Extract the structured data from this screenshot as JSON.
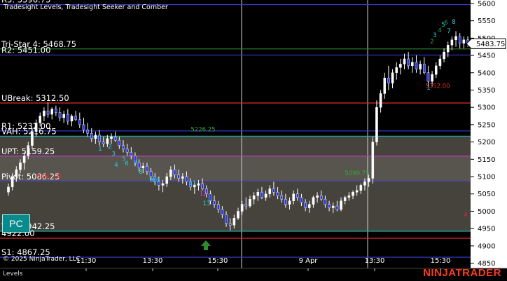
{
  "chart_data": {
    "type": "candlestick",
    "title": "Tradesight Levels, Tradesight Seeker and Comber",
    "x_ticks": [
      "11:30",
      "13:30",
      "15:30",
      "9 Apr",
      "13:30",
      "15:30"
    ],
    "y_ticks": [
      4850,
      4900,
      4950,
      5000,
      5050,
      5100,
      5150,
      5200,
      5250,
      5300,
      5350,
      5400,
      5450,
      5500,
      5550,
      5600
    ],
    "ylim": [
      4835,
      5610
    ],
    "last_price": "5483.75",
    "levels": [
      {
        "label": "R3: 5596.75",
        "value": 5596.75,
        "color": "#3a3ad8"
      },
      {
        "label": "Tri-Star 4: 5468.75",
        "value": 5468.75,
        "color": "#2e7d32"
      },
      {
        "label": "R2: 5451.00",
        "value": 5451.0,
        "color": "#3a3ad8"
      },
      {
        "label": "UBreak: 5312.50",
        "value": 5312.5,
        "color": "#e0292b"
      },
      {
        "label": "R1: 5232.00",
        "value": 5232.0,
        "color": "#3a3ad8"
      },
      {
        "label": "VAH: 5216.75",
        "value": 5216.75,
        "color": "#1fa6a0"
      },
      {
        "label": "UPT: 5159.25",
        "value": 5159.25,
        "color": "#c03ac0"
      },
      {
        "label": "Pivot: 5086.25",
        "value": 5086.25,
        "color": "#3a3ad8"
      },
      {
        "label": "VAL: 4942.25",
        "value": 4942.25,
        "color": "#1fa6a0"
      },
      {
        "label": "4922.00",
        "value": 4922.0,
        "color": "#e0292b"
      },
      {
        "label": "S1: 4867.25",
        "value": 4867.25,
        "color": "#3a3ad8"
      }
    ],
    "annotations": [
      {
        "text": "5226.25",
        "value": 5226.25,
        "color": "#3fa13f"
      },
      {
        "text": "5091.00",
        "value": 5091.0,
        "color": "#e0292b"
      },
      {
        "text": "5099.75",
        "value": 5099.75,
        "color": "#3fa13f"
      },
      {
        "text": "5352.00",
        "value": 5352.0,
        "color": "#e0292b"
      },
      {
        "text": "4",
        "value": 4980,
        "color": "#e0292b"
      }
    ],
    "counts": [
      "1",
      "2",
      "3",
      "4",
      "5",
      "6",
      "7",
      "8",
      "9",
      "10",
      "11",
      "12",
      "13",
      "1",
      "2",
      "3",
      "4",
      "5",
      "6",
      "7",
      "8"
    ],
    "candles": [
      {
        "o": 5055,
        "h": 5080,
        "l": 5045,
        "c": 5070
      },
      {
        "o": 5070,
        "h": 5110,
        "l": 5060,
        "c": 5100
      },
      {
        "o": 5100,
        "h": 5130,
        "l": 5085,
        "c": 5120
      },
      {
        "o": 5120,
        "h": 5150,
        "l": 5110,
        "c": 5140
      },
      {
        "o": 5140,
        "h": 5170,
        "l": 5120,
        "c": 5160
      },
      {
        "o": 5160,
        "h": 5200,
        "l": 5150,
        "c": 5190
      },
      {
        "o": 5190,
        "h": 5240,
        "l": 5180,
        "c": 5230
      },
      {
        "o": 5230,
        "h": 5265,
        "l": 5215,
        "c": 5255
      },
      {
        "o": 5255,
        "h": 5285,
        "l": 5245,
        "c": 5275
      },
      {
        "o": 5275,
        "h": 5300,
        "l": 5260,
        "c": 5290
      },
      {
        "o": 5290,
        "h": 5315,
        "l": 5270,
        "c": 5280
      },
      {
        "o": 5280,
        "h": 5300,
        "l": 5265,
        "c": 5295
      },
      {
        "o": 5295,
        "h": 5305,
        "l": 5275,
        "c": 5285
      },
      {
        "o": 5285,
        "h": 5300,
        "l": 5260,
        "c": 5270
      },
      {
        "o": 5270,
        "h": 5290,
        "l": 5255,
        "c": 5280
      },
      {
        "o": 5280,
        "h": 5295,
        "l": 5250,
        "c": 5260
      },
      {
        "o": 5260,
        "h": 5280,
        "l": 5245,
        "c": 5275
      },
      {
        "o": 5275,
        "h": 5290,
        "l": 5260,
        "c": 5265
      },
      {
        "o": 5265,
        "h": 5285,
        "l": 5240,
        "c": 5250
      },
      {
        "o": 5250,
        "h": 5270,
        "l": 5225,
        "c": 5235
      },
      {
        "o": 5235,
        "h": 5255,
        "l": 5215,
        "c": 5225
      },
      {
        "o": 5225,
        "h": 5240,
        "l": 5200,
        "c": 5210
      },
      {
        "o": 5210,
        "h": 5230,
        "l": 5195,
        "c": 5220
      },
      {
        "o": 5220,
        "h": 5235,
        "l": 5190,
        "c": 5200
      },
      {
        "o": 5200,
        "h": 5215,
        "l": 5185,
        "c": 5195
      },
      {
        "o": 5195,
        "h": 5220,
        "l": 5185,
        "c": 5210
      },
      {
        "o": 5210,
        "h": 5225,
        "l": 5195,
        "c": 5215
      },
      {
        "o": 5215,
        "h": 5230,
        "l": 5200,
        "c": 5205
      },
      {
        "o": 5205,
        "h": 5215,
        "l": 5180,
        "c": 5190
      },
      {
        "o": 5190,
        "h": 5205,
        "l": 5170,
        "c": 5180
      },
      {
        "o": 5180,
        "h": 5195,
        "l": 5160,
        "c": 5170
      },
      {
        "o": 5170,
        "h": 5185,
        "l": 5150,
        "c": 5160
      },
      {
        "o": 5160,
        "h": 5170,
        "l": 5130,
        "c": 5140
      },
      {
        "o": 5140,
        "h": 5150,
        "l": 5115,
        "c": 5125
      },
      {
        "o": 5125,
        "h": 5140,
        "l": 5110,
        "c": 5130
      },
      {
        "o": 5130,
        "h": 5140,
        "l": 5105,
        "c": 5115
      },
      {
        "o": 5115,
        "h": 5125,
        "l": 5090,
        "c": 5100
      },
      {
        "o": 5100,
        "h": 5110,
        "l": 5075,
        "c": 5085
      },
      {
        "o": 5085,
        "h": 5100,
        "l": 5060,
        "c": 5075
      },
      {
        "o": 5075,
        "h": 5090,
        "l": 5055,
        "c": 5080
      },
      {
        "o": 5080,
        "h": 5110,
        "l": 5070,
        "c": 5100
      },
      {
        "o": 5100,
        "h": 5130,
        "l": 5090,
        "c": 5120
      },
      {
        "o": 5120,
        "h": 5135,
        "l": 5095,
        "c": 5105
      },
      {
        "o": 5105,
        "h": 5120,
        "l": 5085,
        "c": 5095
      },
      {
        "o": 5095,
        "h": 5110,
        "l": 5080,
        "c": 5100
      },
      {
        "o": 5100,
        "h": 5115,
        "l": 5075,
        "c": 5085
      },
      {
        "o": 5085,
        "h": 5095,
        "l": 5060,
        "c": 5070
      },
      {
        "o": 5070,
        "h": 5085,
        "l": 5050,
        "c": 5075
      },
      {
        "o": 5075,
        "h": 5090,
        "l": 5060,
        "c": 5080
      },
      {
        "o": 5080,
        "h": 5095,
        "l": 5060,
        "c": 5065
      },
      {
        "o": 5065,
        "h": 5075,
        "l": 5040,
        "c": 5050
      },
      {
        "o": 5050,
        "h": 5060,
        "l": 5020,
        "c": 5030
      },
      {
        "o": 5030,
        "h": 5045,
        "l": 5010,
        "c": 5020
      },
      {
        "o": 5020,
        "h": 5030,
        "l": 4995,
        "c": 5005
      },
      {
        "o": 5005,
        "h": 5015,
        "l": 4980,
        "c": 4990
      },
      {
        "o": 4990,
        "h": 5000,
        "l": 4955,
        "c": 4965
      },
      {
        "o": 4965,
        "h": 4980,
        "l": 4945,
        "c": 4960
      },
      {
        "o": 4960,
        "h": 4990,
        "l": 4950,
        "c": 4980
      },
      {
        "o": 4980,
        "h": 5010,
        "l": 4975,
        "c": 5000
      },
      {
        "o": 5000,
        "h": 5030,
        "l": 4990,
        "c": 5020
      },
      {
        "o": 5020,
        "h": 5040,
        "l": 5005,
        "c": 5015
      },
      {
        "o": 5015,
        "h": 5045,
        "l": 5010,
        "c": 5035
      },
      {
        "o": 5035,
        "h": 5055,
        "l": 5020,
        "c": 5045
      },
      {
        "o": 5045,
        "h": 5065,
        "l": 5030,
        "c": 5055
      },
      {
        "o": 5055,
        "h": 5070,
        "l": 5035,
        "c": 5040
      },
      {
        "o": 5040,
        "h": 5060,
        "l": 5030,
        "c": 5050
      },
      {
        "o": 5050,
        "h": 5075,
        "l": 5040,
        "c": 5065
      },
      {
        "o": 5065,
        "h": 5085,
        "l": 5045,
        "c": 5055
      },
      {
        "o": 5055,
        "h": 5070,
        "l": 5035,
        "c": 5045
      },
      {
        "o": 5045,
        "h": 5060,
        "l": 5025,
        "c": 5035
      },
      {
        "o": 5035,
        "h": 5050,
        "l": 5010,
        "c": 5020
      },
      {
        "o": 5020,
        "h": 5040,
        "l": 5005,
        "c": 5030
      },
      {
        "o": 5030,
        "h": 5060,
        "l": 5020,
        "c": 5050
      },
      {
        "o": 5050,
        "h": 5065,
        "l": 5030,
        "c": 5040
      },
      {
        "o": 5040,
        "h": 5050,
        "l": 5015,
        "c": 5025
      },
      {
        "o": 5025,
        "h": 5035,
        "l": 5000,
        "c": 5010
      },
      {
        "o": 5010,
        "h": 5030,
        "l": 4995,
        "c": 5020
      },
      {
        "o": 5020,
        "h": 5045,
        "l": 5010,
        "c": 5040
      },
      {
        "o": 5040,
        "h": 5055,
        "l": 5025,
        "c": 5045
      },
      {
        "o": 5045,
        "h": 5060,
        "l": 5030,
        "c": 5035
      },
      {
        "o": 5035,
        "h": 5045,
        "l": 5010,
        "c": 5020
      },
      {
        "o": 5020,
        "h": 5030,
        "l": 5000,
        "c": 5010
      },
      {
        "o": 5010,
        "h": 5025,
        "l": 4995,
        "c": 5015
      },
      {
        "o": 5015,
        "h": 5030,
        "l": 5000,
        "c": 5005
      },
      {
        "o": 5005,
        "h": 5040,
        "l": 5000,
        "c": 5030
      },
      {
        "o": 5030,
        "h": 5045,
        "l": 5020,
        "c": 5040
      },
      {
        "o": 5040,
        "h": 5055,
        "l": 5030,
        "c": 5045
      },
      {
        "o": 5045,
        "h": 5060,
        "l": 5035,
        "c": 5055
      },
      {
        "o": 5055,
        "h": 5075,
        "l": 5045,
        "c": 5060
      },
      {
        "o": 5060,
        "h": 5080,
        "l": 5050,
        "c": 5075
      },
      {
        "o": 5075,
        "h": 5095,
        "l": 5060,
        "c": 5085
      },
      {
        "o": 5085,
        "h": 5105,
        "l": 5070,
        "c": 5095
      },
      {
        "o": 5095,
        "h": 5215,
        "l": 5080,
        "c": 5200
      },
      {
        "o": 5200,
        "h": 5320,
        "l": 5190,
        "c": 5300
      },
      {
        "o": 5300,
        "h": 5350,
        "l": 5285,
        "c": 5340
      },
      {
        "o": 5340,
        "h": 5400,
        "l": 5325,
        "c": 5385
      },
      {
        "o": 5385,
        "h": 5420,
        "l": 5350,
        "c": 5370
      },
      {
        "o": 5370,
        "h": 5410,
        "l": 5355,
        "c": 5400
      },
      {
        "o": 5400,
        "h": 5430,
        "l": 5380,
        "c": 5415
      },
      {
        "o": 5415,
        "h": 5440,
        "l": 5395,
        "c": 5425
      },
      {
        "o": 5425,
        "h": 5455,
        "l": 5410,
        "c": 5440
      },
      {
        "o": 5440,
        "h": 5460,
        "l": 5410,
        "c": 5420
      },
      {
        "o": 5420,
        "h": 5445,
        "l": 5400,
        "c": 5430
      },
      {
        "o": 5430,
        "h": 5450,
        "l": 5400,
        "c": 5410
      },
      {
        "o": 5410,
        "h": 5435,
        "l": 5395,
        "c": 5425
      },
      {
        "o": 5425,
        "h": 5445,
        "l": 5395,
        "c": 5400
      },
      {
        "o": 5400,
        "h": 5420,
        "l": 5360,
        "c": 5375
      },
      {
        "o": 5375,
        "h": 5405,
        "l": 5360,
        "c": 5395
      },
      {
        "o": 5395,
        "h": 5430,
        "l": 5385,
        "c": 5420
      },
      {
        "o": 5420,
        "h": 5450,
        "l": 5410,
        "c": 5440
      },
      {
        "o": 5440,
        "h": 5470,
        "l": 5430,
        "c": 5460
      },
      {
        "o": 5460,
        "h": 5490,
        "l": 5445,
        "c": 5480
      },
      {
        "o": 5480,
        "h": 5505,
        "l": 5465,
        "c": 5495
      },
      {
        "o": 5495,
        "h": 5520,
        "l": 5475,
        "c": 5505
      },
      {
        "o": 5505,
        "h": 5515,
        "l": 5470,
        "c": 5485
      },
      {
        "o": 5485,
        "h": 5505,
        "l": 5470,
        "c": 5495
      },
      {
        "o": 5495,
        "h": 5505,
        "l": 5475,
        "c": 5483.75
      }
    ]
  },
  "ui": {
    "pc_button": "PC",
    "copyright": "© 2025 NinjaTrader, LLC",
    "status": "Levels",
    "brand": "NINJATRADER"
  }
}
